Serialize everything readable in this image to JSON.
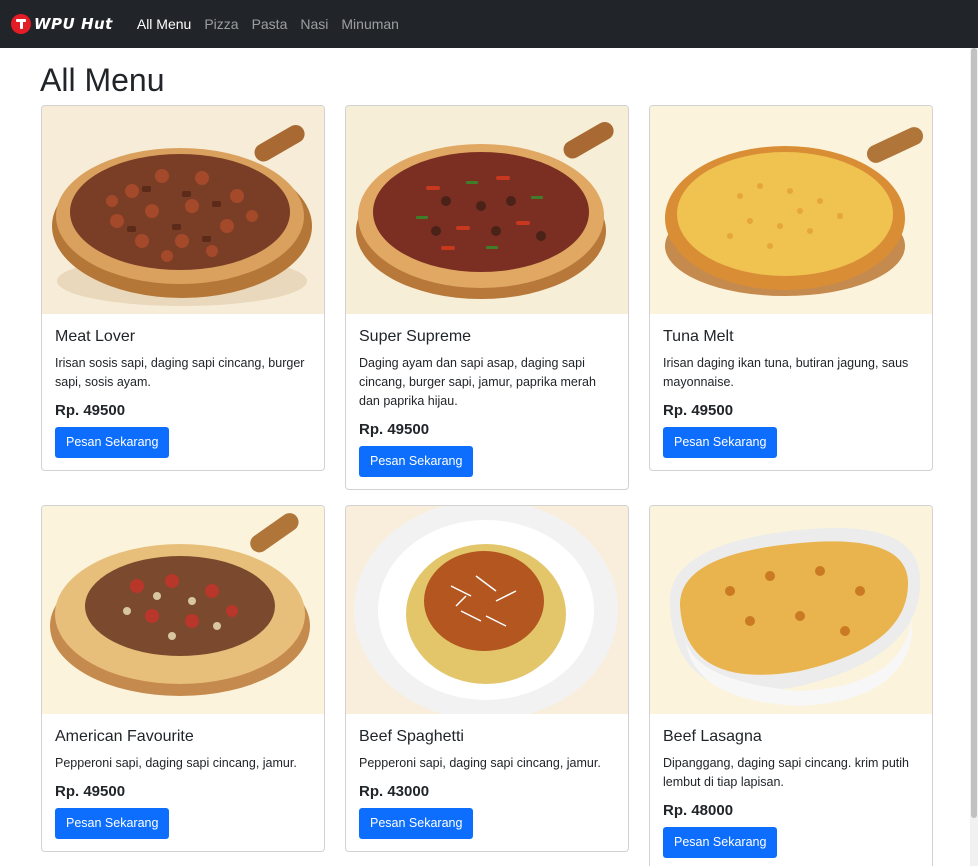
{
  "navbar": {
    "brand": "WPU Hut",
    "links": [
      {
        "label": "All Menu"
      },
      {
        "label": "Pizza"
      },
      {
        "label": "Pasta"
      },
      {
        "label": "Nasi"
      },
      {
        "label": "Minuman"
      }
    ]
  },
  "page": {
    "title": "All Menu"
  },
  "menu": [
    {
      "name": "Meat Lover",
      "description": "Irisan sosis sapi, daging sapi cincang, burger sapi, sosis ayam.",
      "price": "Rp. 49500",
      "button": "Pesan Sekarang"
    },
    {
      "name": "Super Supreme",
      "description": "Daging ayam dan sapi asap, daging sapi cincang, burger sapi, jamur, paprika merah dan paprika hijau.",
      "price": "Rp. 49500",
      "button": "Pesan Sekarang"
    },
    {
      "name": "Tuna Melt",
      "description": "Irisan daging ikan tuna, butiran jagung, saus mayonnaise.",
      "price": "Rp. 49500",
      "button": "Pesan Sekarang"
    },
    {
      "name": "American Favourite",
      "description": "Pepperoni sapi, daging sapi cincang, jamur.",
      "price": "Rp. 49500",
      "button": "Pesan Sekarang"
    },
    {
      "name": "Beef Spaghetti",
      "description": "Pepperoni sapi, daging sapi cincang, jamur.",
      "price": "Rp. 43000",
      "button": "Pesan Sekarang"
    },
    {
      "name": "Beef Lasagna",
      "description": "Dipanggang, daging sapi cincang. krim putih lembut di tiap lapisan.",
      "price": "Rp. 48000",
      "button": "Pesan Sekarang"
    }
  ]
}
